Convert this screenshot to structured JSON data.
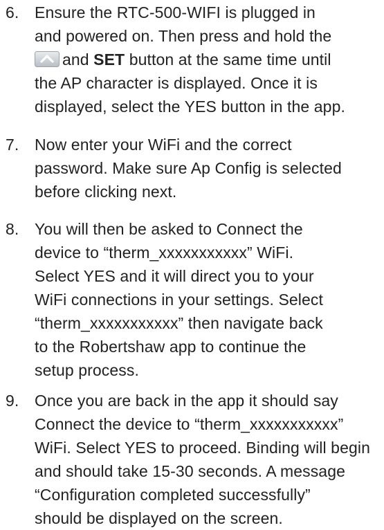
{
  "steps": [
    {
      "number": "6.",
      "lines": [
        "Ensure the RTC-500-WIFI is plugged in",
        "and powered on. Then press and hold the",
        null,
        "the AP character is displayed. Once it is",
        "displayed, select the YES button in the app."
      ],
      "line3_parts": {
        "icon": "up-arrow-button-icon",
        "before_bold": "and ",
        "bold": "SET",
        "after_bold": " button at the same time until"
      }
    },
    {
      "number": "7.",
      "lines": [
        "Now enter your WiFi and the correct",
        "password. Make sure Ap Config is selected",
        "before clicking next."
      ]
    },
    {
      "number": "8.",
      "lines": [
        "You will then be asked to Connect the",
        "device to “therm_xxxxxxxxxxx” WiFi.",
        "Select YES and it will direct you to your",
        "WiFi connections in your settings. Select",
        "“therm_xxxxxxxxxxx” then navigate back",
        "to the Robertshaw app to continue the",
        "setup process."
      ]
    },
    {
      "number": "9.",
      "lines": [
        "Once you are back in the app it should say",
        "Connect the device to “therm_xxxxxxxxxxx”",
        "WiFi. Select YES to proceed. Binding will begin",
        "and should take 15-30 seconds. A message",
        "“Configuration completed successfully”",
        "should be displayed on the screen."
      ]
    }
  ]
}
